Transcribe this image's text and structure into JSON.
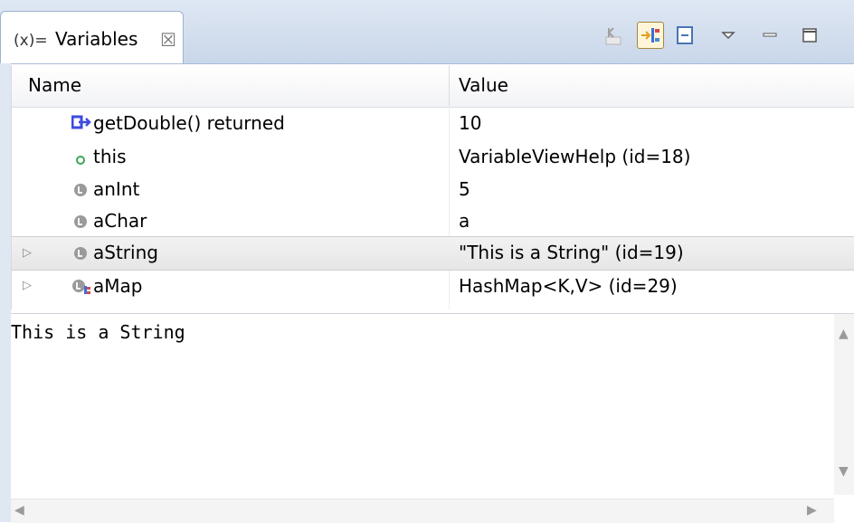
{
  "view": {
    "title": "Variables",
    "tab_icon": "(x)=",
    "close_glyph": "☒",
    "toolbar": [
      {
        "name": "show-type-names-icon",
        "pressed": false
      },
      {
        "name": "show-logical-structure-icon",
        "pressed": true
      },
      {
        "name": "collapse-all-icon",
        "pressed": false
      },
      {
        "name": "view-menu-icon",
        "pressed": false
      },
      {
        "name": "minimize-icon",
        "pressed": false
      },
      {
        "name": "maximize-icon",
        "pressed": false
      }
    ]
  },
  "table": {
    "columns": [
      "Name",
      "Value"
    ],
    "rows": [
      {
        "name": "getDouble() returned",
        "value": "10",
        "icon": "method-return-icon",
        "expandable": false,
        "selected": false
      },
      {
        "name": "this",
        "value": "VariableViewHelp  (id=18)",
        "icon": "this-object-icon",
        "expandable": false,
        "selected": false
      },
      {
        "name": "anInt",
        "value": "5",
        "icon": "local-variable-icon",
        "expandable": false,
        "selected": false
      },
      {
        "name": "aChar",
        "value": "a",
        "icon": "local-variable-icon",
        "expandable": false,
        "selected": false
      },
      {
        "name": "aString",
        "value": "\"This is a String\" (id=19)",
        "icon": "local-variable-icon",
        "expandable": true,
        "selected": true
      },
      {
        "name": "aMap",
        "value": "HashMap<K,V>  (id=29)",
        "icon": "logical-structure-variable-icon",
        "expandable": true,
        "selected": false
      }
    ]
  },
  "details": {
    "text": "This is a String"
  },
  "colors": {
    "tab_bar": "#c9d7ea",
    "method_return": "#3d4be0",
    "this_icon": "#3aa655",
    "local_icon": "#8a8a8a"
  }
}
